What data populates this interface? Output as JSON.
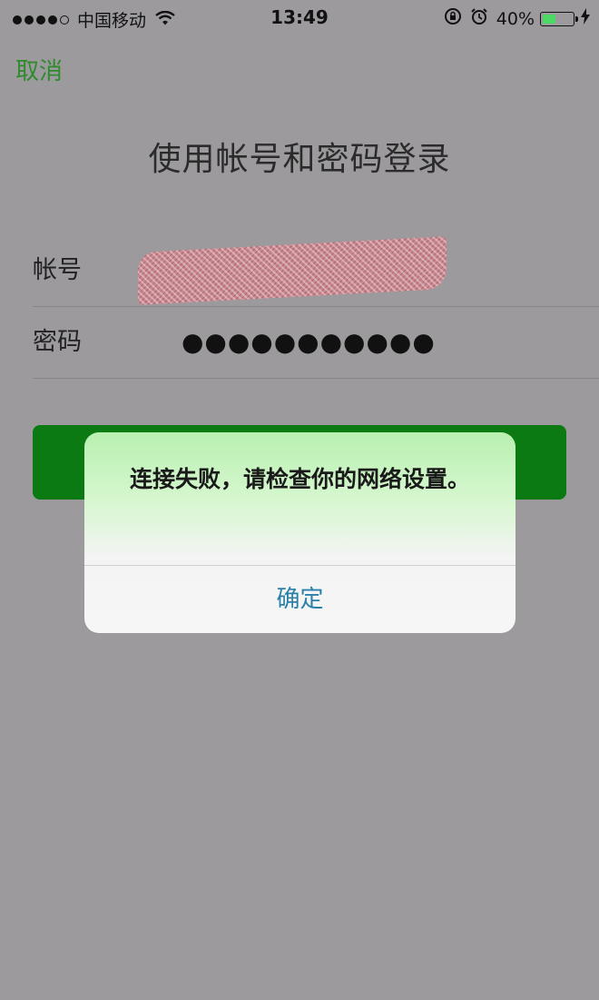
{
  "status_bar": {
    "carrier": "中国移动",
    "time": "13:49",
    "battery": "40%"
  },
  "nav": {
    "cancel": "取消"
  },
  "page_title": "使用帐号和密码登录",
  "form": {
    "account_label": "帐号",
    "password_label": "密码",
    "password_value": "●●●●●●●●●●●"
  },
  "alert": {
    "message": "连接失败，请检查你的网络设置。",
    "confirm": "确定"
  },
  "colors": {
    "accent": "#2e8b2e",
    "login_button": "#0b7a12",
    "alert_button_text": "#2a80a9"
  },
  "icons": [
    "signal-dots-icon",
    "wifi-icon",
    "orientation-lock-icon",
    "alarm-icon",
    "battery-icon",
    "charging-bolt-icon"
  ]
}
